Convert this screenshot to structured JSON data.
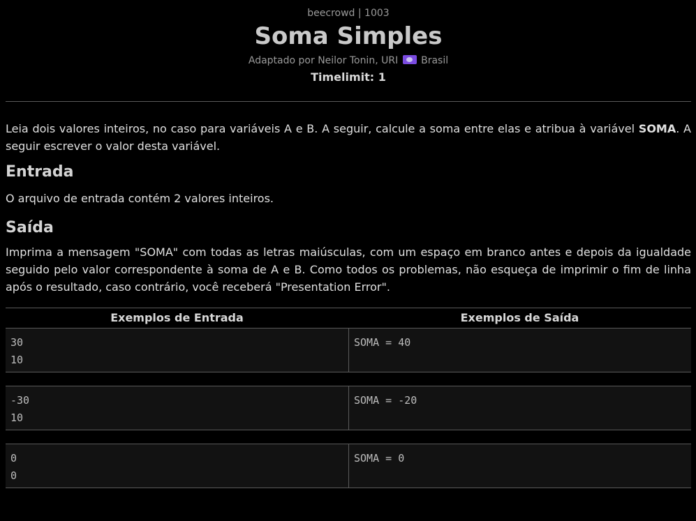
{
  "header": {
    "site": "beecrowd | 1003",
    "title": "Soma Simples",
    "author_prefix": "Adaptado por Neilor Tonin, URI",
    "author_country": "Brasil",
    "timelimit": "Timelimit: 1",
    "flag_icon": "brazil-flag-icon",
    "flag_color": "#7a4be0"
  },
  "description": {
    "part1": "Leia dois valores inteiros, no caso para variáveis A e B. A seguir, calcule a soma entre elas e atribua à variável ",
    "bold": "SOMA",
    "part2": ". A seguir escrever o valor desta variável."
  },
  "entrada": {
    "title": "Entrada",
    "text": "O arquivo de entrada contém 2 valores inteiros."
  },
  "saida": {
    "title": "Saída",
    "text": "Imprima a mensagem \"SOMA\" com todas as letras maiúsculas, com um espaço em branco antes e depois da igualdade seguido pelo valor correspondente à soma de A e B. Como todos os problemas, não esqueça de imprimir o fim de linha após o resultado, caso contrário, você receberá \"Presentation Error\"."
  },
  "samples": {
    "input_header": "Exemplos de Entrada",
    "output_header": "Exemplos de Saída",
    "rows": [
      {
        "input": "30\n10",
        "output": "SOMA = 40"
      },
      {
        "input": "-30\n10",
        "output": "SOMA = -20"
      },
      {
        "input": "0\n0",
        "output": "SOMA = 0"
      }
    ]
  }
}
